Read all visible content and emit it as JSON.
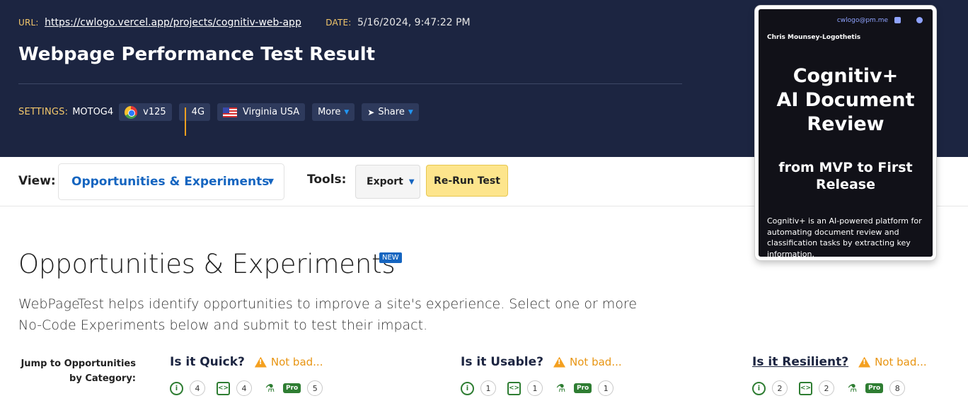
{
  "header": {
    "url_label": "URL:",
    "url": "https://cwlogo.vercel.app/projects/cognitiv-web-app",
    "date_label": "DATE:",
    "date": "5/16/2024, 9:47:22 PM",
    "title": "Webpage Performance Test Result",
    "settings_label": "SETTINGS:",
    "device": "MOTOG4",
    "browser": "v125",
    "browser_icon": "chrome-icon",
    "connection": "4G",
    "connection_icon": "signal-bars-icon",
    "location": "Virginia USA",
    "location_icon": "us-flag-icon",
    "more_label": "More",
    "share_label": "Share"
  },
  "toolbar": {
    "view_label": "View:",
    "view_value": "Opportunities & Experiments",
    "tools_label": "Tools:",
    "export_label": "Export",
    "rerun_label": "Re-Run Test"
  },
  "main": {
    "title": "Opportunities & Experiments",
    "badge": "NEW",
    "intro": "WebPageTest helps identify opportunities to improve a site's experience. Select one or more No-Code Experiments below and submit to test their impact.",
    "jump_label": "Jump to Opportunities by Category:",
    "categories": [
      {
        "title": "Is it Quick?",
        "verdict": "Not bad...",
        "observations": "4",
        "experiments": "4",
        "pro": "Pro",
        "pro_count": "5"
      },
      {
        "title": "Is it Usable?",
        "verdict": "Not bad...",
        "observations": "1",
        "experiments": "1",
        "pro": "Pro",
        "pro_count": "1"
      },
      {
        "title": "Is it Resilient?",
        "verdict": "Not bad...",
        "observations": "2",
        "experiments": "2",
        "pro": "Pro",
        "pro_count": "8"
      }
    ]
  },
  "card": {
    "email": "cwlogo@pm.me",
    "author": "Chris Mounsey-Logothetis",
    "title_line1": "Cognitiv+",
    "title_line2": "AI Document",
    "title_line3": "Review",
    "subtitle_line1": "from MVP to First",
    "subtitle_line2": "Release",
    "description": "Cognitiv+ is an AI-powered platform for automating document review and classification tasks by extracting key information."
  },
  "colors": {
    "header_bg": "#1c2541",
    "accent_blue": "#1565c0",
    "warning": "#e89512",
    "success": "#2e7d32",
    "rerun_bg": "#fde58c"
  }
}
